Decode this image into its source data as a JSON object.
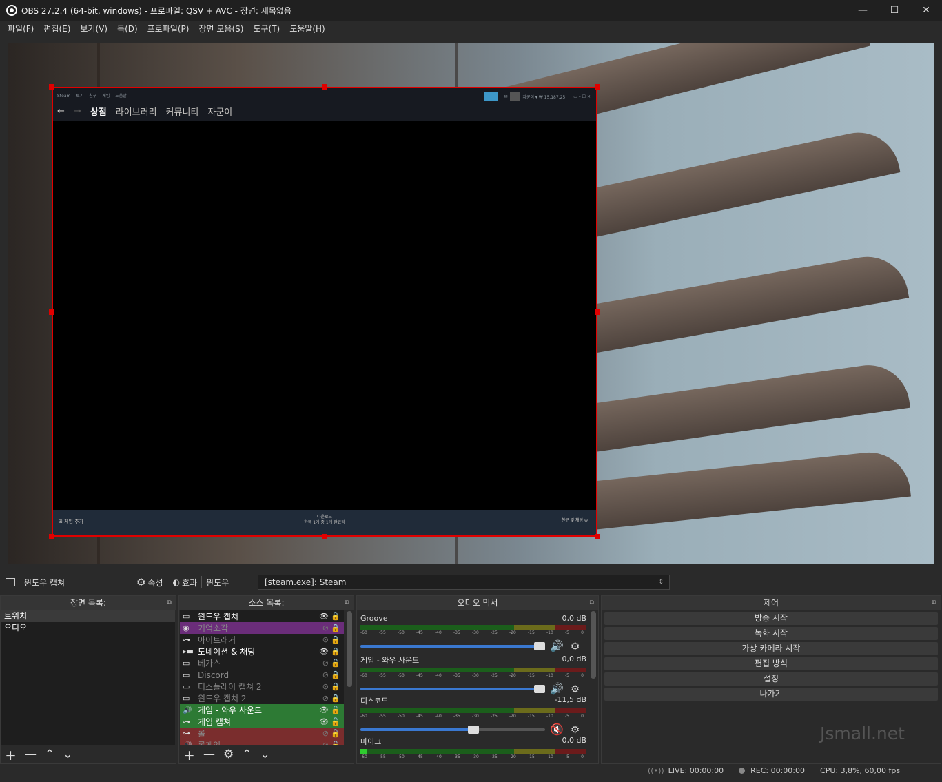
{
  "window": {
    "title": "OBS 27.2.4 (64-bit, windows) - 프로파일: QSV + AVC - 장면: 제목없음",
    "minimize": "—",
    "maximize": "☐",
    "close": "✕"
  },
  "menu": [
    "파일(F)",
    "편집(E)",
    "보기(V)",
    "독(D)",
    "프로파일(P)",
    "장면 모음(S)",
    "도구(T)",
    "도움말(H)"
  ],
  "steam": {
    "menu": [
      "Steam",
      "보기",
      "친구",
      "게임",
      "도움말"
    ],
    "nav": [
      "상점",
      "라이브러리",
      "커뮤니티",
      "자군이"
    ],
    "account": "자군이 ▾ ₩ 15,187.25",
    "add_game": "게임 추가",
    "downloads_title": "다운로드",
    "downloads_sub": "한목 1개 중 1개 완료됨",
    "friends": "친구 및 채팅"
  },
  "source_bar": {
    "name": "윈도우 캡쳐",
    "properties": "속성",
    "filters": "효과",
    "window_label": "윈도우",
    "window_value": "[steam.exe]: Steam"
  },
  "scenes": {
    "header": "장면 목록:",
    "items": [
      "트위치",
      "오디오"
    ]
  },
  "sources": {
    "header": "소스 목록:",
    "items": [
      {
        "name": "윈도우 캡쳐",
        "icon": "▭",
        "style": "",
        "eye": "👁",
        "lock": "🔓"
      },
      {
        "name": "기억소각",
        "icon": "◉",
        "style": "purple hid",
        "eye": "⊘",
        "lock": "🔒"
      },
      {
        "name": "아이트래커",
        "icon": "⊶",
        "style": "hid",
        "eye": "⊘",
        "lock": "🔒"
      },
      {
        "name": "도네이션 & 채팅",
        "icon": "▸▬",
        "style": "",
        "eye": "👁",
        "lock": "🔒"
      },
      {
        "name": "베가스",
        "icon": "▭",
        "style": "hid",
        "eye": "⊘",
        "lock": "🔓"
      },
      {
        "name": "Discord",
        "icon": "▭",
        "style": "hid",
        "eye": "⊘",
        "lock": "🔒"
      },
      {
        "name": "디스플레이 캡쳐 2",
        "icon": "▭",
        "style": "hid",
        "eye": "⊘",
        "lock": "🔒"
      },
      {
        "name": "윈도우 캡쳐 2",
        "icon": "▭",
        "style": "hid",
        "eye": "⊘",
        "lock": "🔒"
      },
      {
        "name": "게임 - 와우 사운드",
        "icon": "🔊",
        "style": "green",
        "eye": "👁",
        "lock": "🔓"
      },
      {
        "name": "게임 캡쳐",
        "icon": "⊶",
        "style": "green",
        "eye": "👁",
        "lock": "🔓"
      },
      {
        "name": "롤",
        "icon": "⊶",
        "style": "red hid",
        "eye": "⊘",
        "lock": "🔓"
      },
      {
        "name": "롤게임",
        "icon": "🔊",
        "style": "red hid",
        "eye": "⊘",
        "lock": "🔓"
      }
    ]
  },
  "mixer": {
    "header": "오디오 믹서",
    "ticks": [
      "-60",
      "-55",
      "-50",
      "-45",
      "-40",
      "-35",
      "-30",
      "-25",
      "-20",
      "-15",
      "-10",
      "-5",
      "0"
    ],
    "channels": [
      {
        "name": "Groove",
        "db": "0,0 dB",
        "volume": 1.0,
        "level": 0.0,
        "muted": false
      },
      {
        "name": "게임 - 와우 사운드",
        "db": "0,0 dB",
        "volume": 1.0,
        "level": 0.0,
        "muted": false
      },
      {
        "name": "디스코드",
        "db": "-11,5 dB",
        "volume": 0.62,
        "level": 0.0,
        "muted": true
      },
      {
        "name": "마이크",
        "db": "0,0 dB",
        "volume": 1.0,
        "level": 0.03,
        "muted": false
      }
    ]
  },
  "controls": {
    "header": "제어",
    "buttons": [
      "방송 시작",
      "녹화 시작",
      "가상 카메라 시작",
      "편집 방식",
      "설정",
      "나가기"
    ]
  },
  "watermark": "Jsmall.net",
  "status": {
    "live": "LIVE: 00:00:00",
    "rec": "REC: 00:00:00",
    "cpu": "CPU: 3,8%, 60,00 fps"
  }
}
